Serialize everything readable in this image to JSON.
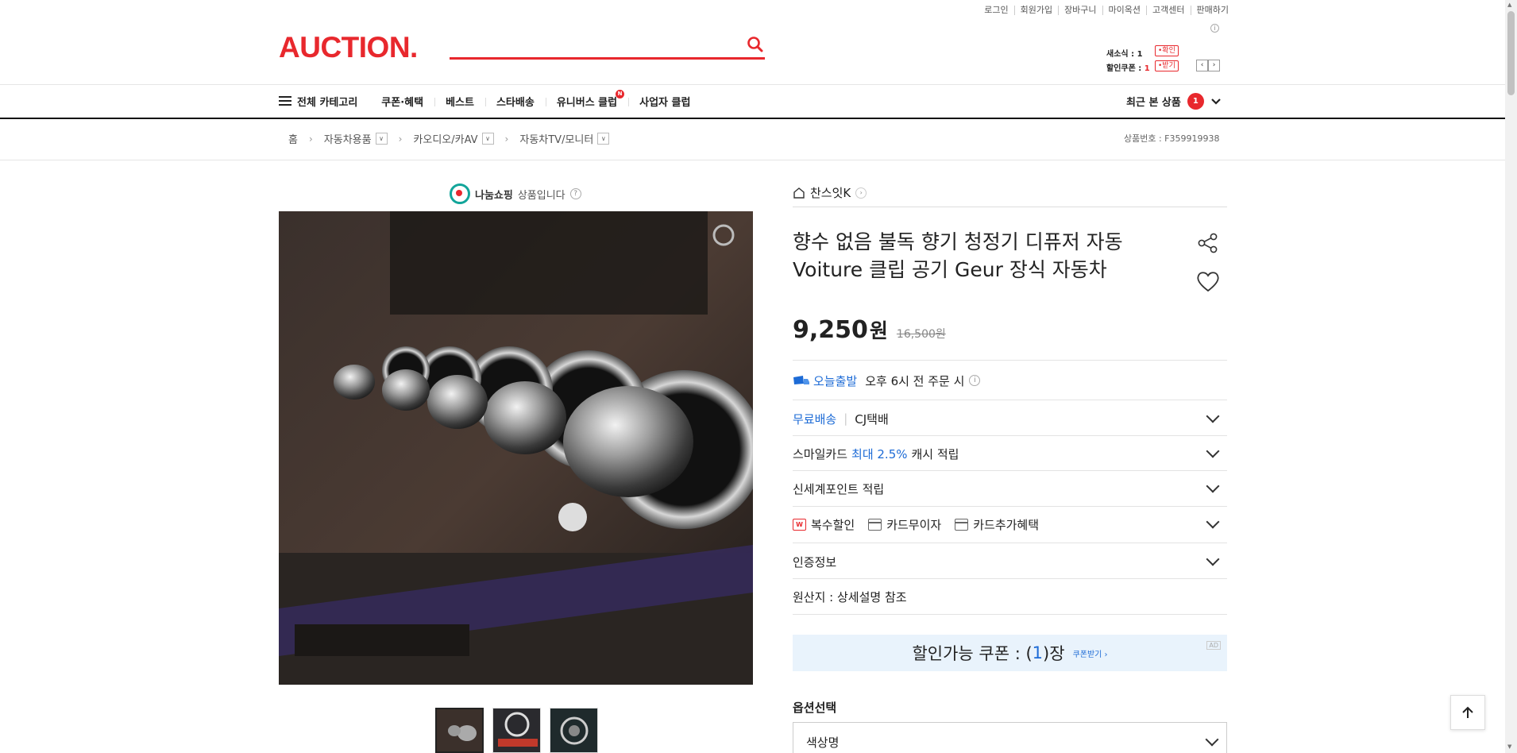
{
  "header": {
    "util_links": [
      "로그인",
      "회원가입",
      "장바구니",
      "마이옥션",
      "고객센터",
      "판매하기"
    ],
    "logo": "AUCTION.",
    "info_mark": "i",
    "mini": {
      "new_label": "새소식 : ",
      "new_count": "1",
      "new_btn": "•확인",
      "coupon_label": "할인쿠폰 : ",
      "coupon_count": "1",
      "coupon_btn": "•받기",
      "prev": "‹",
      "next": "›"
    }
  },
  "nav": {
    "all_category": "전체 카테고리",
    "items": [
      "쿠폰·혜택",
      "베스트",
      "스타배송",
      "유니버스 클럽",
      "사업자 클럽"
    ],
    "new_badge": "N",
    "recent_label": "최근 본 상품",
    "recent_count": "1"
  },
  "breadcrumb": {
    "home": "홈",
    "items": [
      "자동차용품",
      "카오디오/카AV",
      "자동차TV/모니터"
    ],
    "product_no": "상품번호 : F359919938"
  },
  "product": {
    "nanum_brand": "나눔쇼핑",
    "nanum_text": "상품입니다",
    "help": "?",
    "store": "찬스잇K",
    "title": "향수 없음 불독 향기 청정기 디퓨저 자동 Voiture 클립 공기 Geur 장식 자동차",
    "price": "9,250",
    "price_unit": "원",
    "original_price": "16,500원",
    "today_ship": "오늘출발",
    "today_ship_desc": "오후 6시 전 주문 시",
    "free_ship": "무료배송",
    "courier": "CJ택배",
    "smilecard_prefix": "스마일카드",
    "smilecard_rate": "최대 2.5%",
    "smilecard_suffix": "캐시 적립",
    "shinsegae": "신세계포인트 적립",
    "multi_discount": "복수할인",
    "card_free": "카드무이자",
    "card_extra": "카드추가혜택",
    "cert": "인증정보",
    "origin": "원산지 : 상세설명 참조",
    "coupon_prefix": "할인가능 쿠폰 : (",
    "coupon_count": "1",
    "coupon_suffix": ")장",
    "coupon_more": "쿠폰받기 ›",
    "ad": "AD",
    "option_label": "옵션선택",
    "option_value": "색상명"
  },
  "colors": {
    "brand_red": "#e8282d",
    "accent_blue": "#1d6bd6",
    "coupon_bg": "#e9f3fc"
  }
}
